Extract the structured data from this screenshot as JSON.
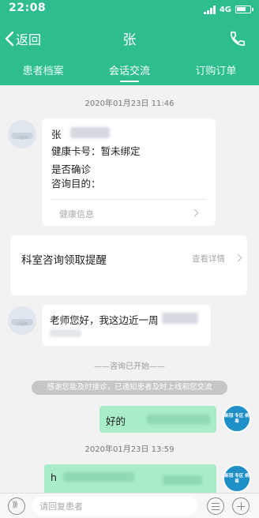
{
  "status_bar": {
    "time": "22:08",
    "network": "4G"
  },
  "nav": {
    "back_label": "返回",
    "title": "张"
  },
  "tabs": [
    {
      "label": "患者档案"
    },
    {
      "label": "会话交流",
      "active": true
    },
    {
      "label": "订购订单"
    }
  ],
  "chat": {
    "timestamp_1": "2020年01月23日 11:46",
    "info_card": {
      "name_line": "张",
      "line_2": "健康卡号：暂未绑定",
      "line_3": "是否确诊",
      "line_4": "咨询目的：",
      "footer": "健康信息"
    },
    "notice_card": {
      "title": "科室咨询领取提醒",
      "link": "查看详情"
    },
    "doctor_message": "老师您好，我这边近一周",
    "consult_started": "——咨询已开始——",
    "system_notice": "感谢您能及时接诊，已通知患者及时上线和您交流",
    "reply_1": "好的",
    "timestamp_2": "2020年01月23日 13:59",
    "reply_2": "h",
    "avatar_doctor_text": "小程序",
    "avatar_hospital_text": "新冠 专区 病毒"
  },
  "input_bar": {
    "placeholder": "请回复患者"
  },
  "colors": {
    "brand_green": "#2dbe8c",
    "reply_bubble": "#a8ecc8",
    "hospital_avatar": "#1f8fc7"
  },
  "icons": {
    "back": "chevron-left-icon",
    "phone": "phone-icon",
    "voice": "voice-icon",
    "menu": "list-icon",
    "plus": "plus-icon"
  }
}
